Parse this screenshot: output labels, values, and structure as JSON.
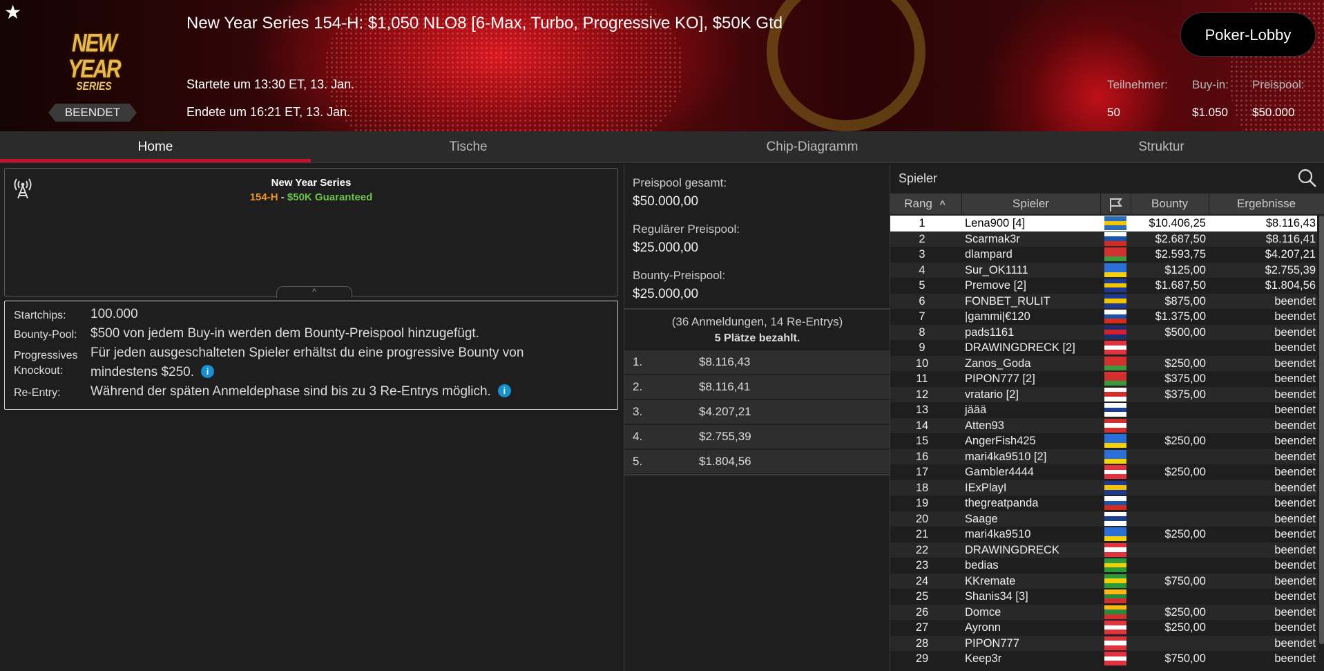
{
  "header": {
    "title": "New Year Series 154-H: $1,050 NLO8 [6-Max, Turbo, Progressive KO], $50K Gtd",
    "logo_line1": "NEW YEAR",
    "logo_line2": "SERIES",
    "status_badge": "BEENDET",
    "started": "Startete um 13:30 ET, 13. Jan.",
    "ended": "Endete um 16:21 ET, 13. Jan.",
    "lobby_button": "Poker-Lobby",
    "stats": {
      "participants_label": "Teilnehmer:",
      "participants_value": "50",
      "buyin_label": "Buy-in:",
      "buyin_value": "$1.050",
      "prizepool_label": "Preispool:",
      "prizepool_value": "$50.000"
    }
  },
  "tabs": [
    "Home",
    "Tische",
    "Chip-Diagramm",
    "Struktur"
  ],
  "active_tab": "Home",
  "info": {
    "title": "New Year Series",
    "sub_id": "154-H",
    "sub_dash": " - ",
    "sub_guarantee": "$50K Guaranteed",
    "collapse_glyph": "^"
  },
  "details": {
    "startchips_label": "Startchips:",
    "startchips_value": "100.000",
    "bounty_label": "Bounty-Pool:",
    "bounty_value": "$500 von jedem Buy-in werden dem Bounty-Preispool hinzugefügt.",
    "pko_label_1": "Progressives",
    "pko_label_2": "Knockout:",
    "pko_value_1": "Für jeden ausgeschalteten Spieler erhältst du eine progressive Bounty von",
    "pko_value_2": "mindestens $250.",
    "reentry_label": "Re-Entry:",
    "reentry_value": "Während der späten Anmeldephase sind bis zu 3 Re-Entrys möglich.",
    "info_glyph": "i"
  },
  "prizepool": {
    "total_label": "Preispool gesamt:",
    "total_value": "$50.000,00",
    "regular_label": "Regulärer Preispool:",
    "regular_value": "$25.000,00",
    "bounty_label": "Bounty-Preispool:",
    "bounty_value": "$25.000,00",
    "entries": "(36 Anmeldungen, 14 Re-Entrys)",
    "paid": "5 Plätze bezahlt.",
    "payouts": [
      {
        "place": "1.",
        "amount": "$8.116,43"
      },
      {
        "place": "2.",
        "amount": "$8.116,41"
      },
      {
        "place": "3.",
        "amount": "$4.207,21"
      },
      {
        "place": "4.",
        "amount": "$2.755,39"
      },
      {
        "place": "5.",
        "amount": "$1.804,56"
      }
    ]
  },
  "players": {
    "search_label": "Spieler",
    "columns": {
      "rank": "Rang",
      "player": "Spieler",
      "bounty": "Bounty",
      "result": "Ergebnisse"
    },
    "sort_glyph": "^",
    "colors": {
      "accent": "#c8102e",
      "info": "#1a8fcf",
      "guarantee": "#6cc24a",
      "event_id": "#f0922a"
    },
    "rows": [
      {
        "rank": "1",
        "name": "Lena900 [4]",
        "flag": [
          "#2a6ebb",
          "#f0c800",
          "#2a6ebb"
        ],
        "bounty": "$10.406,25",
        "result": "$8.116,43"
      },
      {
        "rank": "2",
        "name": "Scarmak3r",
        "flag": [
          "#ffffff",
          "#1c54a8",
          "#d52b1e"
        ],
        "bounty": "$2.687,50",
        "result": "$8.116,41"
      },
      {
        "rank": "3",
        "name": "dlampard",
        "flag": [
          "#d22f2f",
          "#d22f2f",
          "#3c9a3c"
        ],
        "bounty": "$2.593,75",
        "result": "$4.207,21"
      },
      {
        "rank": "4",
        "name": "Sur_OK1111",
        "flag": [
          "#2a6fd6",
          "#2a6fd6",
          "#f6d10a"
        ],
        "bounty": "$125,00",
        "result": "$2.755,39"
      },
      {
        "rank": "5",
        "name": "Premove [2]",
        "flag": [
          "#1c3a8f",
          "#f5c400",
          "#1c3a8f"
        ],
        "bounty": "$1.687,50",
        "result": "$1.804,56"
      },
      {
        "rank": "6",
        "name": "FONBET_RULIT",
        "flag": [
          "#1c3a8f",
          "#f5c400",
          "#1c3a8f"
        ],
        "bounty": "$875,00",
        "result": "beendet"
      },
      {
        "rank": "7",
        "name": "|gammi|€120",
        "flag": [
          "#ffffff",
          "#1c54a8",
          "#d52b1e"
        ],
        "bounty": "$1.375,00",
        "result": "beendet"
      },
      {
        "rank": "8",
        "name": "pads1161",
        "flag": [
          "#1d2f6f",
          "#d42030",
          "#1d2f6f"
        ],
        "bounty": "$500,00",
        "result": "beendet"
      },
      {
        "rank": "9",
        "name": "DRAWINGDRECK [2]",
        "flag": [
          "#e0333f",
          "#ffffff",
          "#e0333f"
        ],
        "bounty": "",
        "result": "beendet"
      },
      {
        "rank": "10",
        "name": "Zanos_Goda",
        "flag": [
          "#d22f2f",
          "#d22f2f",
          "#3c9a3c"
        ],
        "bounty": "$250,00",
        "result": "beendet"
      },
      {
        "rank": "11",
        "name": "PIPON777 [2]",
        "flag": [
          "#d22f2f",
          "#d22f2f",
          "#3c9a3c"
        ],
        "bounty": "$375,00",
        "result": "beendet"
      },
      {
        "rank": "12",
        "name": "vratario [2]",
        "flag": [
          "#ffffff",
          "#d22f2f",
          "#ffffff"
        ],
        "bounty": "$375,00",
        "result": "beendet"
      },
      {
        "rank": "13",
        "name": "jäää",
        "flag": [
          "#ffffff",
          "#1c3f8f",
          "#ffffff"
        ],
        "bounty": "",
        "result": "beendet"
      },
      {
        "rank": "14",
        "name": "Atten93",
        "flag": [
          "#d22f2f",
          "#ffffff",
          "#d22f2f"
        ],
        "bounty": "",
        "result": "beendet"
      },
      {
        "rank": "15",
        "name": "AngerFish425",
        "flag": [
          "#2a6fd6",
          "#2a6fd6",
          "#f6d10a"
        ],
        "bounty": "$250,00",
        "result": "beendet"
      },
      {
        "rank": "16",
        "name": "mari4ka9510 [2]",
        "flag": [
          "#2a6fd6",
          "#2a6fd6",
          "#f6d10a"
        ],
        "bounty": "",
        "result": "beendet"
      },
      {
        "rank": "17",
        "name": "Gambler4444",
        "flag": [
          "#e0333f",
          "#ffffff",
          "#e0333f"
        ],
        "bounty": "$250,00",
        "result": "beendet"
      },
      {
        "rank": "18",
        "name": "IExPlayI",
        "flag": [
          "#1c3a8f",
          "#f5c400",
          "#1c3a8f"
        ],
        "bounty": "",
        "result": "beendet"
      },
      {
        "rank": "19",
        "name": "thegreatpanda",
        "flag": [
          "#ffffff",
          "#1c54a8",
          "#d52b1e"
        ],
        "bounty": "",
        "result": "beendet"
      },
      {
        "rank": "20",
        "name": "Saage",
        "flag": [
          "#ffffff",
          "#1c3f8f",
          "#ffffff"
        ],
        "bounty": "",
        "result": "beendet"
      },
      {
        "rank": "21",
        "name": "mari4ka9510",
        "flag": [
          "#2a6fd6",
          "#2a6fd6",
          "#f6d10a"
        ],
        "bounty": "$250,00",
        "result": "beendet"
      },
      {
        "rank": "22",
        "name": "DRAWINGDRECK",
        "flag": [
          "#e0333f",
          "#ffffff",
          "#e0333f"
        ],
        "bounty": "",
        "result": "beendet"
      },
      {
        "rank": "23",
        "name": "bedias",
        "flag": [
          "#2a9a3a",
          "#f5d000",
          "#2a9a3a"
        ],
        "bounty": "",
        "result": "beendet"
      },
      {
        "rank": "24",
        "name": "KKremate",
        "flag": [
          "#2a9a3a",
          "#f5d000",
          "#2a9a3a"
        ],
        "bounty": "$750,00",
        "result": "beendet"
      },
      {
        "rank": "25",
        "name": "Shanis34 [3]",
        "flag": [
          "#fdb913",
          "#2a8a3a",
          "#d22f2f"
        ],
        "bounty": "",
        "result": "beendet"
      },
      {
        "rank": "26",
        "name": "Domce",
        "flag": [
          "#fdb913",
          "#2a8a3a",
          "#d22f2f"
        ],
        "bounty": "$250,00",
        "result": "beendet"
      },
      {
        "rank": "27",
        "name": "Ayronn",
        "flag": [
          "#e0333f",
          "#ffffff",
          "#e0333f"
        ],
        "bounty": "$250,00",
        "result": "beendet"
      },
      {
        "rank": "28",
        "name": "PIPON777",
        "flag": [
          "#e0333f",
          "#ffffff",
          "#e0333f"
        ],
        "bounty": "",
        "result": "beendet"
      },
      {
        "rank": "29",
        "name": "Keep3r",
        "flag": [
          "#e0333f",
          "#ffffff",
          "#e0333f"
        ],
        "bounty": "$750,00",
        "result": "beendet"
      }
    ]
  }
}
